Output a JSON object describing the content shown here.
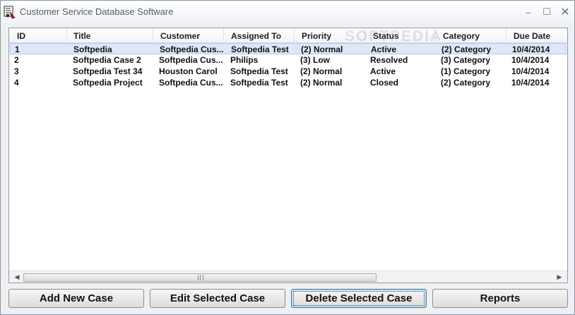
{
  "window": {
    "title": "Customer Service Database Software"
  },
  "watermark": "SOFTPEDIA",
  "table": {
    "columns": [
      "ID",
      "Title",
      "Customer",
      "Assigned To",
      "Priority",
      "Status",
      "Category",
      "Due Date"
    ],
    "rows": [
      [
        "1",
        "Softpedia",
        "Softpedia Cus...",
        "Softpedia Test",
        "(2) Normal",
        "Active",
        "(2) Category",
        "10/4/2014"
      ],
      [
        "2",
        "Softpedia Case 2",
        "Softpedia Cus...",
        "Philips",
        "(3) Low",
        "Resolved",
        "(3) Category",
        "10/4/2014"
      ],
      [
        "3",
        "Softpedia Test 34",
        "Houston Carol",
        "Softpedia Test",
        "(2) Normal",
        "Active",
        "(1) Category",
        "10/4/2014"
      ],
      [
        "4",
        "Softpedia Project",
        "Softpedia Cus...",
        "Softpedia Test",
        "(2) Normal",
        "Closed",
        "(2) Category",
        "10/4/2014"
      ]
    ],
    "selected_row": 0
  },
  "scrollbar": {
    "left_arrow": "◀",
    "right_arrow": "▶"
  },
  "buttons": {
    "add_new_case": "Add New Case",
    "edit_selected_case": "Edit Selected Case",
    "delete_selected_case": "Delete Selected Case",
    "reports": "Reports"
  },
  "window_controls": {
    "minimize": "–",
    "maximize": "☐",
    "close": "✕"
  },
  "colors": {
    "selection": "#dce8f8",
    "window_bg": "#f0f0f0"
  }
}
